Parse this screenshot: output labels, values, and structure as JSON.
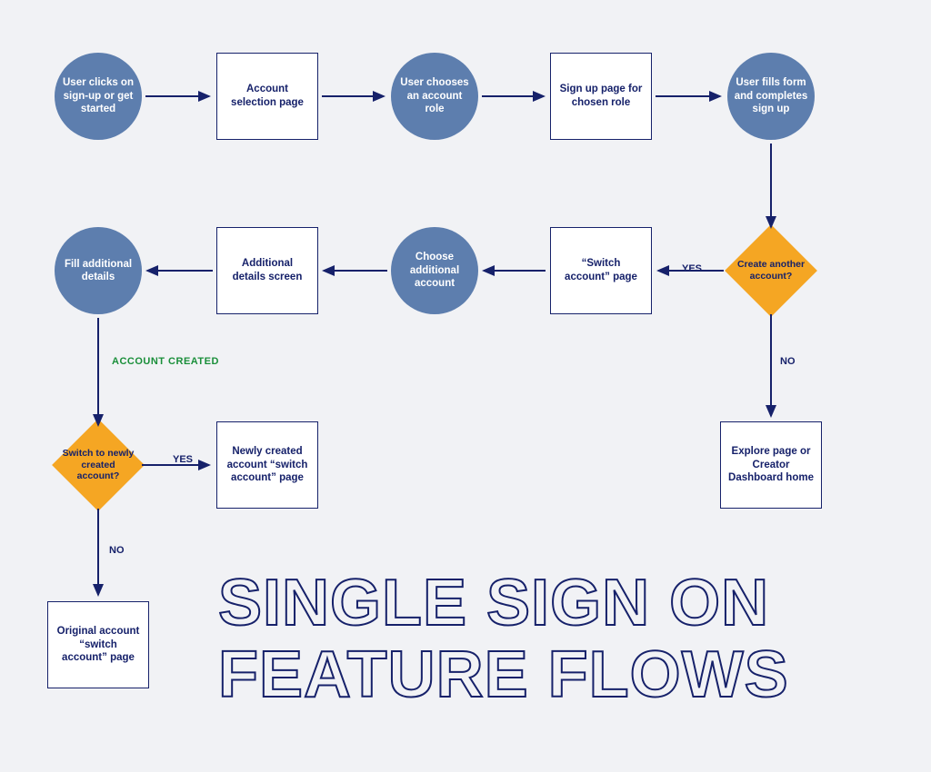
{
  "title_line1": "SINGLE SIGN ON",
  "title_line2": "FEATURE FLOWS",
  "colors": {
    "circle_fill": "#5d7eae",
    "rect_border": "#16216a",
    "diamond_fill": "#f5a623",
    "canvas_bg": "#f1f2f5",
    "edge_stroke": "#16216a",
    "account_created_label": "#1a8f3a"
  },
  "nodes": {
    "n1": {
      "type": "circle",
      "text": "User clicks on sign-up or get started"
    },
    "n2": {
      "type": "rect",
      "text": "Account selection page"
    },
    "n3": {
      "type": "circle",
      "text": "User chooses an account role"
    },
    "n4": {
      "type": "rect",
      "text": "Sign up page for chosen role"
    },
    "n5": {
      "type": "circle",
      "text": "User fills form and completes sign up"
    },
    "n6": {
      "type": "diamond",
      "text": "Create another account?"
    },
    "n7": {
      "type": "rect",
      "text": "“Switch account” page"
    },
    "n8": {
      "type": "circle",
      "text": "Choose additional account"
    },
    "n9": {
      "type": "rect",
      "text": "Additional details screen"
    },
    "n10": {
      "type": "circle",
      "text": "Fill additional details"
    },
    "n11": {
      "type": "diamond",
      "text": "Switch to newly created account?"
    },
    "n12": {
      "type": "rect",
      "text": "Newly created account “switch account” page"
    },
    "n13": {
      "type": "rect",
      "text": "Original account “switch account” page"
    },
    "n14": {
      "type": "rect",
      "text": "Explore page or Creator Dashboard home"
    }
  },
  "edge_labels": {
    "yes1": "YES",
    "no1": "NO",
    "account_created": "ACCOUNT CREATED",
    "yes2": "YES",
    "no2": "NO"
  },
  "edges_description": [
    "n1 → n2",
    "n2 → n3",
    "n3 → n4",
    "n4 → n5",
    "n5 ↓ n6",
    "n6 ← YES → n7",
    "n6 ↓ NO → n14",
    "n7 ← n8",
    "n8 ← n9",
    "n9 ← n10",
    "n10 ↓ ACCOUNT CREATED → n11",
    "n11 → YES → n12",
    "n11 ↓ NO → n13"
  ]
}
